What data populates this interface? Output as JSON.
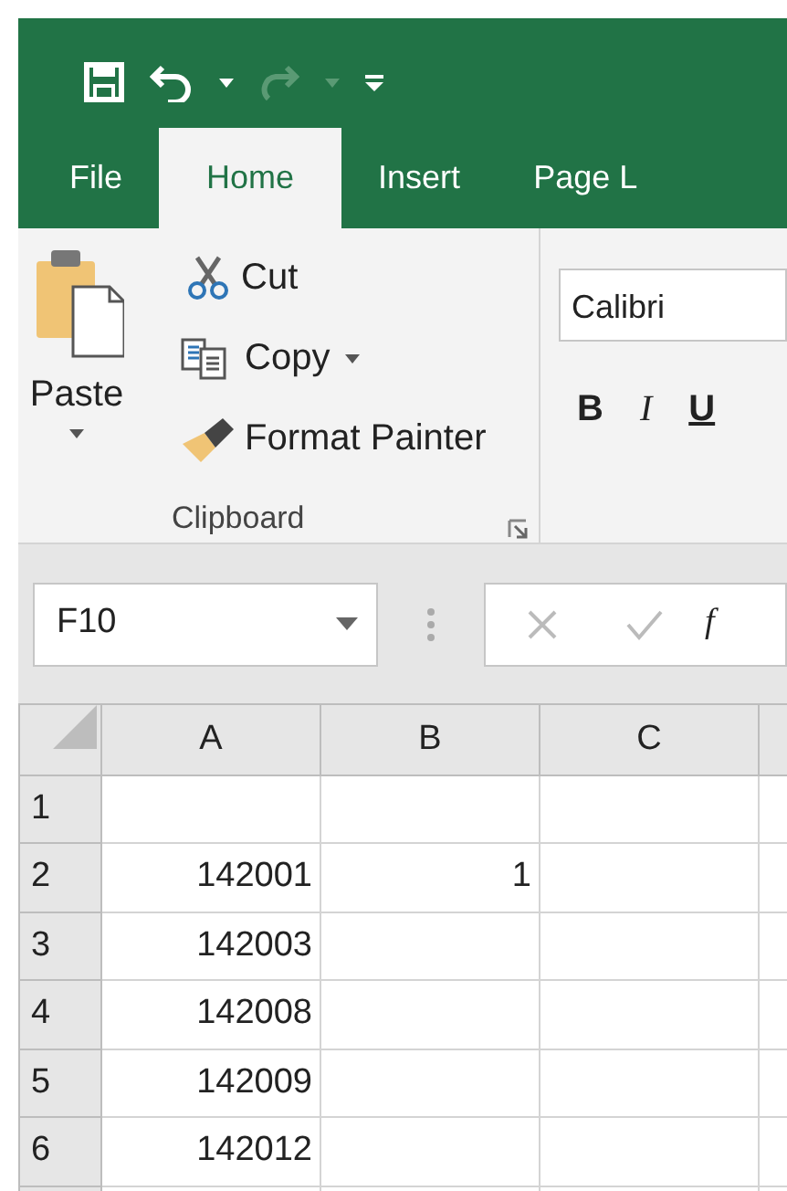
{
  "quick_access": {
    "redo_disabled": true
  },
  "tabs": [
    {
      "label": "File",
      "selected": false
    },
    {
      "label": "Home",
      "selected": true
    },
    {
      "label": "Insert",
      "selected": false
    },
    {
      "label": "Page L",
      "selected": false
    }
  ],
  "clipboard": {
    "paste": "Paste",
    "cut": "Cut",
    "copy": "Copy",
    "format_painter": "Format Painter",
    "group_label": "Clipboard"
  },
  "font": {
    "name": "Calibri",
    "bold": "B",
    "italic": "I",
    "underline": "U"
  },
  "name_box": {
    "value": "F10"
  },
  "formula_bar": {
    "function_label": "f"
  },
  "sheet": {
    "columns": [
      "A",
      "B",
      "C"
    ],
    "rows": [
      {
        "header": "1"
      },
      {
        "header": "2",
        "column_a": "142001",
        "column_b": "1"
      },
      {
        "header": "3",
        "column_a": "142003"
      },
      {
        "header": "4",
        "column_a": "142008"
      },
      {
        "header": "5",
        "column_a": "142009"
      },
      {
        "header": "6",
        "column_a": "142012"
      }
    ]
  }
}
